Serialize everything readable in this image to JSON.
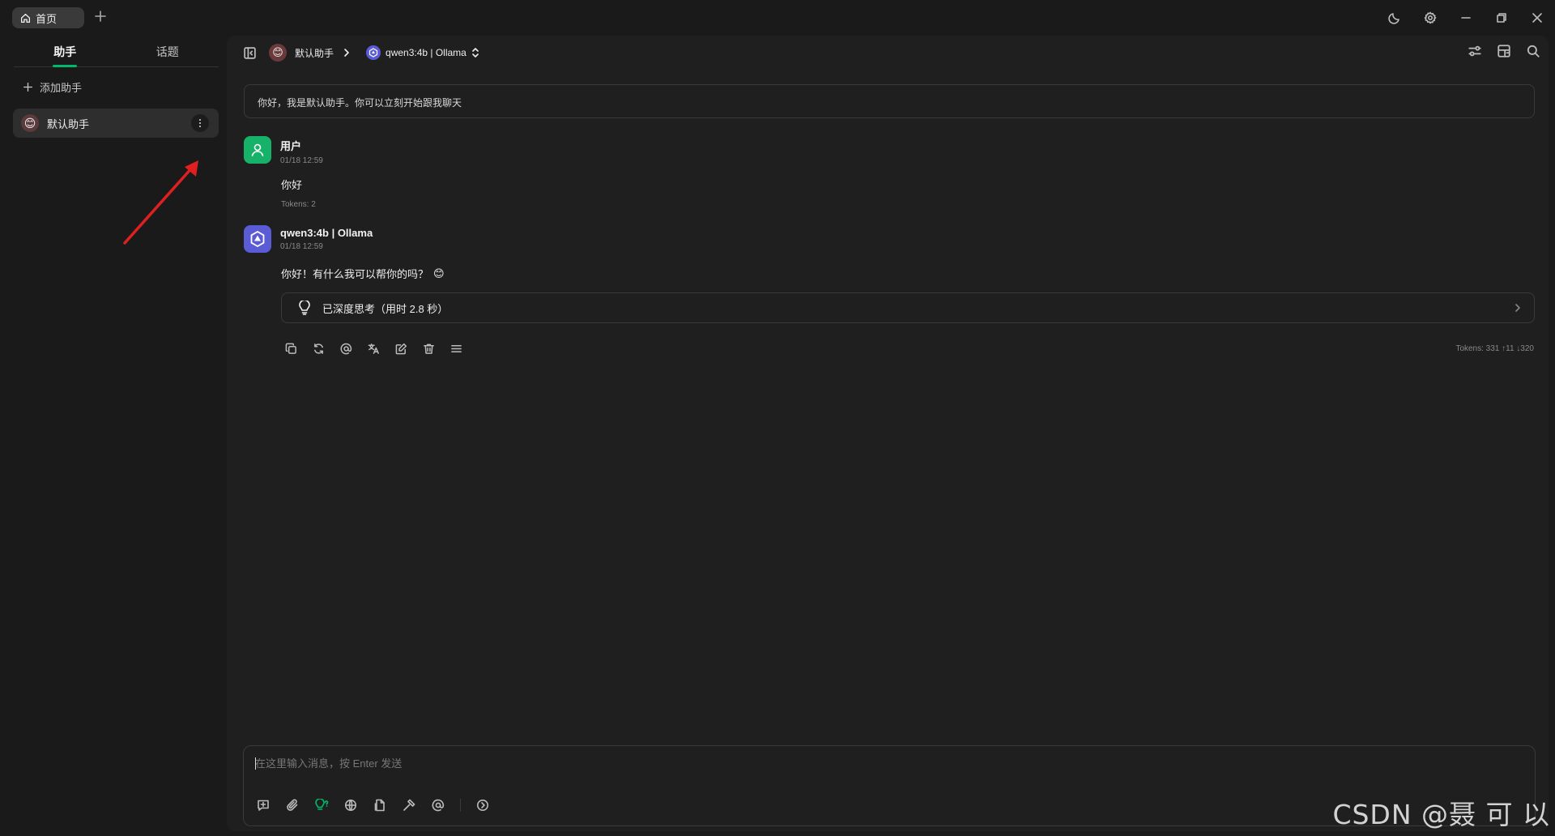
{
  "window": {
    "home_tab": "首页"
  },
  "sidebar": {
    "tabs": [
      {
        "label": "助手",
        "active": true
      },
      {
        "label": "话题",
        "active": false
      }
    ],
    "add_label": "添加助手",
    "assistants": [
      {
        "name": "默认助手",
        "avatar": "😊",
        "selected": true
      }
    ]
  },
  "header": {
    "assistant": "默认助手",
    "model": "qwen3:4b | Ollama"
  },
  "welcome": "你好，我是默认助手。你可以立刻开始跟我聊天",
  "messages": [
    {
      "role": "user",
      "name": "用户",
      "time": "01/18 12:59",
      "text": "你好",
      "tokens": "Tokens: 2"
    },
    {
      "role": "assistant",
      "name": "qwen3:4b | Ollama",
      "time": "01/18 12:59",
      "text": "你好！有什么我可以帮你的吗？",
      "emoji": "😊",
      "thinking": "已深度思考（用时 2.8 秒）",
      "tokens": "Tokens: 331 ↑11 ↓320"
    }
  ],
  "composer": {
    "placeholder": "在这里输入消息，按 Enter 发送"
  },
  "watermark": "CSDN @聂 可 以",
  "colors": {
    "accent": "#00b96b",
    "user_avatar": "#17b26a",
    "model_avatar": "#5b5bd6",
    "annotation_arrow": "#e02020"
  }
}
